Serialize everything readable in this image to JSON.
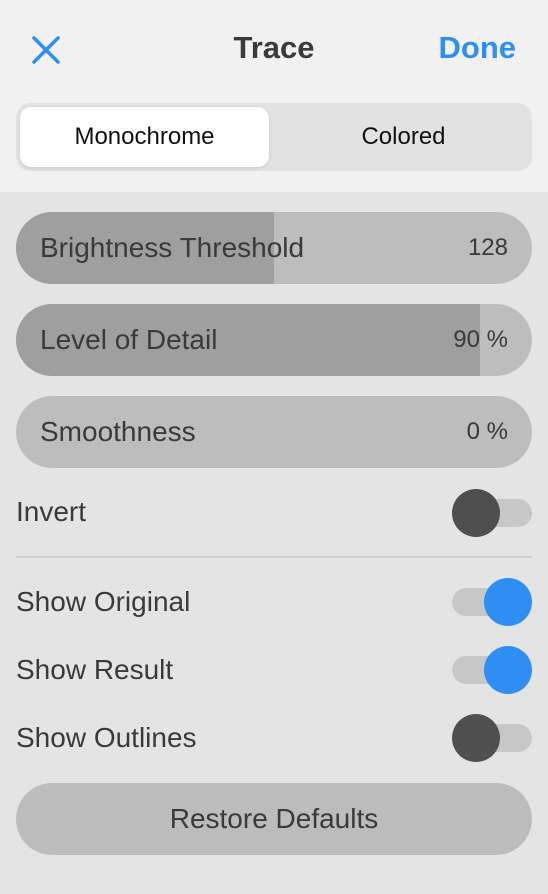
{
  "header": {
    "title": "Trace",
    "done_label": "Done",
    "close_icon": "close-icon",
    "accent_color": "#2f8ef3"
  },
  "mode_tabs": [
    {
      "label": "Monochrome",
      "selected": true
    },
    {
      "label": "Colored",
      "selected": false
    }
  ],
  "sliders": [
    {
      "label": "Brightness Threshold",
      "value": "128",
      "fill_fraction": 0.5
    },
    {
      "label": "Level of Detail",
      "value": "90 %",
      "fill_fraction": 0.9
    },
    {
      "label": "Smoothness",
      "value": "0 %",
      "fill_fraction": 0.0
    }
  ],
  "toggles": {
    "invert": {
      "label": "Invert",
      "on": false
    },
    "show_original": {
      "label": "Show Original",
      "on": true
    },
    "show_result": {
      "label": "Show Result",
      "on": true
    },
    "show_outlines": {
      "label": "Show Outlines",
      "on": false
    }
  },
  "restore_label": "Restore Defaults"
}
